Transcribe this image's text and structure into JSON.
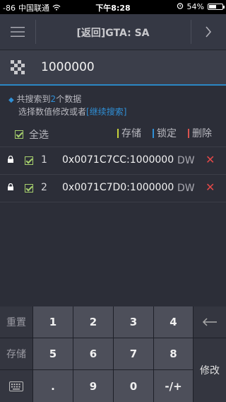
{
  "status_bar": {
    "signal": "-86",
    "carrier": "中国联通",
    "time": "下午8:28",
    "battery": "54%",
    "battery_level": 0.54
  },
  "nav": {
    "title": "[返回]GTA: SA",
    "menu_icon": "hamburger-icon",
    "next_icon": "chevron-right-icon"
  },
  "search": {
    "value": "1000000",
    "icon": "checker-icon"
  },
  "info": {
    "line1_prefix": "共搜索到",
    "count": "2",
    "line1_suffix": "个数据",
    "line2_prefix": "选择数值修改或者",
    "continue_link": "[继续搜索]"
  },
  "toolbar": {
    "select_all": "全选",
    "save": "存储",
    "lock": "锁定",
    "delete": "删除"
  },
  "results": [
    {
      "index": "1",
      "address": "0x0071C7CC:1000000",
      "type": "DW"
    },
    {
      "index": "2",
      "address": "0x0071C7D0:1000000",
      "type": "DW"
    }
  ],
  "keypad": {
    "reset": "重置",
    "store": "存储",
    "keys": [
      "1",
      "2",
      "3",
      "4",
      "5",
      "6",
      "7",
      "8",
      ".",
      "9",
      "0",
      "-/+"
    ],
    "backspace_icon": "backspace-arrow-icon",
    "keyboard_icon": "keyboard-icon",
    "modify": "修改"
  },
  "colors": {
    "accent_blue": "#2f8fd6",
    "save_bar": "#c7d23a",
    "lock_bar": "#2f8fd6",
    "delete_bar": "#d9534f",
    "check_green": "#a6d06d",
    "delete_red": "#e24848"
  }
}
